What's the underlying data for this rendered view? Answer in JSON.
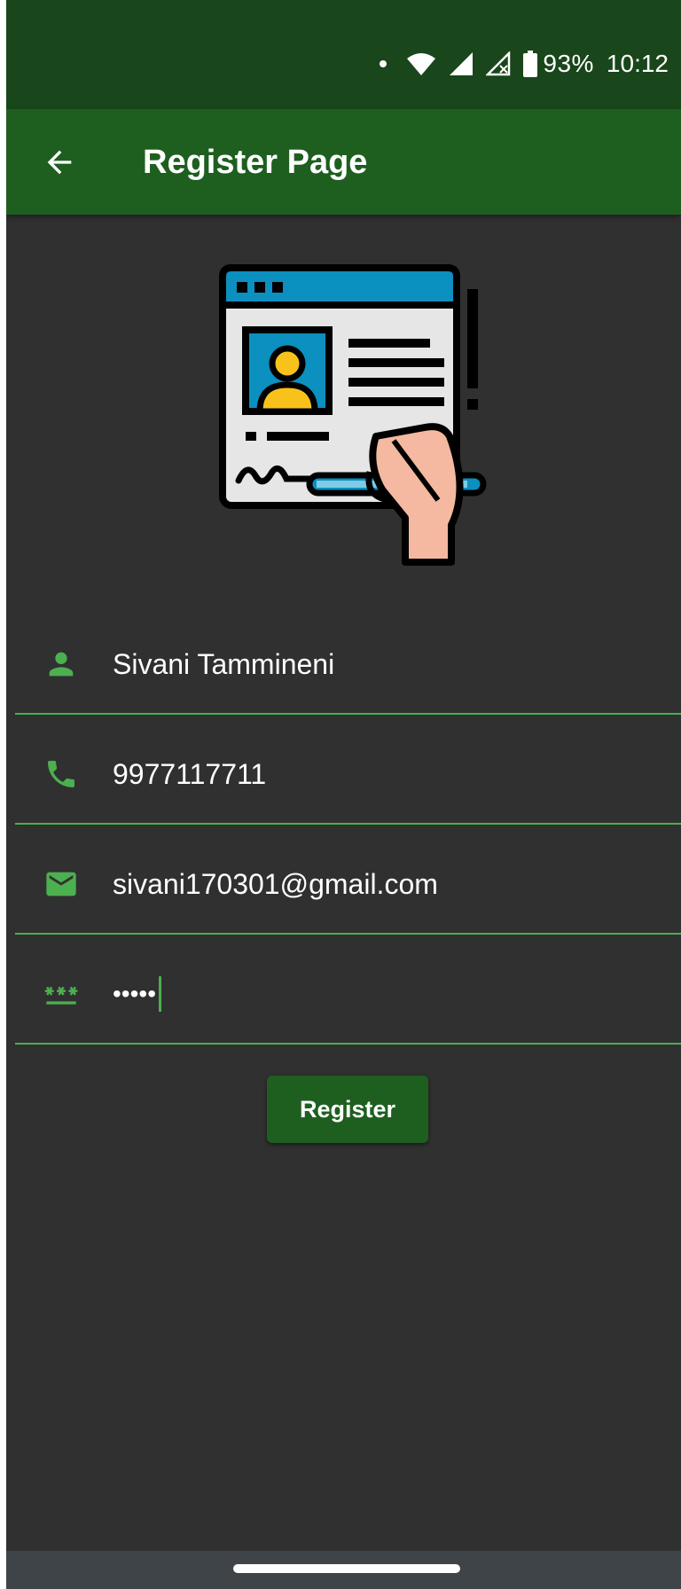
{
  "status_bar": {
    "battery": "93%",
    "time": "10:12"
  },
  "app_bar": {
    "title": "Register Page",
    "back_icon": "arrow-back-icon"
  },
  "hero": {
    "icon": "register-form-signing-illustration"
  },
  "form": {
    "name": {
      "value": "Sivani Tammineni",
      "icon": "person-icon"
    },
    "phone": {
      "value": "9977117711",
      "icon": "phone-icon"
    },
    "email": {
      "value": "sivani170301@gmail.com",
      "icon": "email-icon"
    },
    "password": {
      "masked_value": "•••••",
      "icon": "password-icon"
    }
  },
  "register_button": {
    "label": "Register"
  },
  "colors": {
    "status_bar": "#19461b",
    "app_bar": "#1e5f20",
    "background": "#303030",
    "accent": "#4caf50",
    "nav_bar": "#3f4449"
  }
}
